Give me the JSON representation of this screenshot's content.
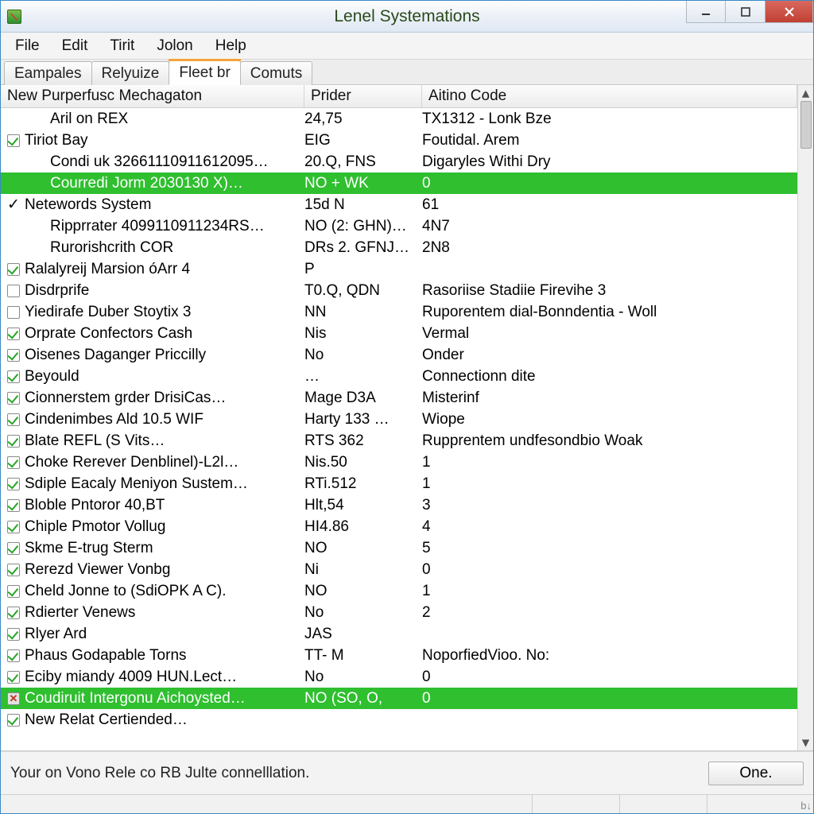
{
  "window": {
    "title": "Lenel Systemations"
  },
  "menubar": [
    "File",
    "Edit",
    "Tirit",
    "Jolon",
    "Help"
  ],
  "tabs": [
    {
      "label": "Eampales",
      "active": false
    },
    {
      "label": "Relyuize",
      "active": false
    },
    {
      "label": "Fleet br",
      "active": true
    },
    {
      "label": "Comuts",
      "active": false
    }
  ],
  "columns": [
    "New Purperfusc Mechagaton",
    "Prider",
    "Aitino Code"
  ],
  "rows": [
    {
      "check": "",
      "indent": 1,
      "c0": "Aril on REX",
      "c1": "24,75",
      "c2": "TX1312 - Lonk Bze",
      "sel": false
    },
    {
      "check": "green",
      "indent": 0,
      "c0": "Tiriot Bay",
      "c1": "EIG",
      "c2": "Foutidal. Arem",
      "sel": false
    },
    {
      "check": "",
      "indent": 1,
      "c0": "Condi uk 32661110911612095…",
      "c1": "20.Q, FNS",
      "c2": "Digaryles Withi Dry",
      "sel": false
    },
    {
      "check": "",
      "indent": 1,
      "c0": "Courredi Jorm 2030130 X)…",
      "c1": "NO + WK",
      "c2": "0",
      "sel": true
    },
    {
      "check": "plain",
      "indent": 0,
      "c0": "Netewords System",
      "c1": "15d N",
      "c2": "61",
      "sel": false
    },
    {
      "check": "",
      "indent": 1,
      "c0": "Ripprrater 4099110911234RS…",
      "c1": "NO  (2: GHN)…",
      "c2": "4N7",
      "sel": false
    },
    {
      "check": "",
      "indent": 1,
      "c0": "Rurorishcrith COR",
      "c1": "DRs 2. GFNJ…",
      "c2": "2N8",
      "sel": false
    },
    {
      "check": "green",
      "indent": 0,
      "c0": "Ralalyreij Marsion óArr 4",
      "c1": "P",
      "c2": "",
      "sel": false
    },
    {
      "check": "empty",
      "indent": 0,
      "c0": "Disdrprife",
      "c1": "T0.Q, QDN",
      "c2": "Rasoriise Stadiie Firevihe 3",
      "sel": false
    },
    {
      "check": "empty",
      "indent": 0,
      "c0": "Yiedirafe Duber Stoytix 3",
      "c1": "NN",
      "c2": "Ruporentem dial-Bonndentia - Woll",
      "sel": false
    },
    {
      "check": "green",
      "indent": 0,
      "c0": "Orprate Confectors Cash",
      "c1": "Nis",
      "c2": "Vermal",
      "sel": false
    },
    {
      "check": "green",
      "indent": 0,
      "c0": "Oisenes Daganger Priccilly",
      "c1": "No",
      "c2": "Onder",
      "sel": false
    },
    {
      "check": "green",
      "indent": 0,
      "c0": "Beyould",
      "c1": "…",
      "c2": "Connectionn dite",
      "sel": false
    },
    {
      "check": "green",
      "indent": 0,
      "c0": "Cionnerstem grder DrisiCas…",
      "c1": "Mage D3A",
      "c2": "Misterinf",
      "sel": false
    },
    {
      "check": "green",
      "indent": 0,
      "c0": "Cindenimbes Ald 10.5 WIF",
      "c1": "Harty 133 …",
      "c2": "Wiope",
      "sel": false
    },
    {
      "check": "green",
      "indent": 0,
      "c0": "Blate REFL (S Vits…",
      "c1": "RTS 362",
      "c2": "Rupprentem undfesondbio Woak",
      "sel": false
    },
    {
      "check": "green",
      "indent": 0,
      "c0": "Choke Rerever Denblinel)-L2l…",
      "c1": "Nis.50",
      "c2": "1",
      "sel": false
    },
    {
      "check": "green",
      "indent": 0,
      "c0": "Sdiple Eacaly Meniyon Sustem…",
      "c1": "RTi.512",
      "c2": "1",
      "sel": false
    },
    {
      "check": "green",
      "indent": 0,
      "c0": "Bloble Pntoror 40,BT",
      "c1": "Hlt,54",
      "c2": "3",
      "sel": false
    },
    {
      "check": "green",
      "indent": 0,
      "c0": "Chiple Pmotor Vollug",
      "c1": "HI4.86",
      "c2": "4",
      "sel": false
    },
    {
      "check": "green",
      "indent": 0,
      "c0": "Skme E-trug Sterm",
      "c1": "NO",
      "c2": "5",
      "sel": false
    },
    {
      "check": "green",
      "indent": 0,
      "c0": "Rerezd Viewer Vonbg",
      "c1": "Ni",
      "c2": "0",
      "sel": false
    },
    {
      "check": "green",
      "indent": 0,
      "c0": "Cheld Jonne to (SdiOPK A C).",
      "c1": "NO",
      "c2": "1",
      "sel": false
    },
    {
      "check": "green",
      "indent": 0,
      "c0": "Rdierter Venews",
      "c1": "No",
      "c2": "2",
      "sel": false
    },
    {
      "check": "green",
      "indent": 0,
      "c0": "Rlyer Ard",
      "c1": "JAS",
      "c2": "",
      "sel": false
    },
    {
      "check": "green",
      "indent": 0,
      "c0": "Phaus Godapable Torns",
      "c1": "TT- M",
      "c2": "NoporfiedVioo. No:",
      "sel": false
    },
    {
      "check": "green",
      "indent": 0,
      "c0": "Eciby miandy 4009 HUN.Lect…",
      "c1": "No",
      "c2": "0",
      "sel": false
    },
    {
      "check": "red",
      "indent": 0,
      "c0": "Coudiruit Intergonu Aichoysted…",
      "c1": "NO (SO, O,",
      "c2": "0",
      "sel": true
    },
    {
      "check": "green",
      "indent": 0,
      "c0": "New Relat Certiended…",
      "c1": "",
      "c2": "",
      "sel": false
    }
  ],
  "footer": {
    "status": "Your on Vono Rele co RB Julte connelllation.",
    "button": "One."
  },
  "grip": "b↓"
}
